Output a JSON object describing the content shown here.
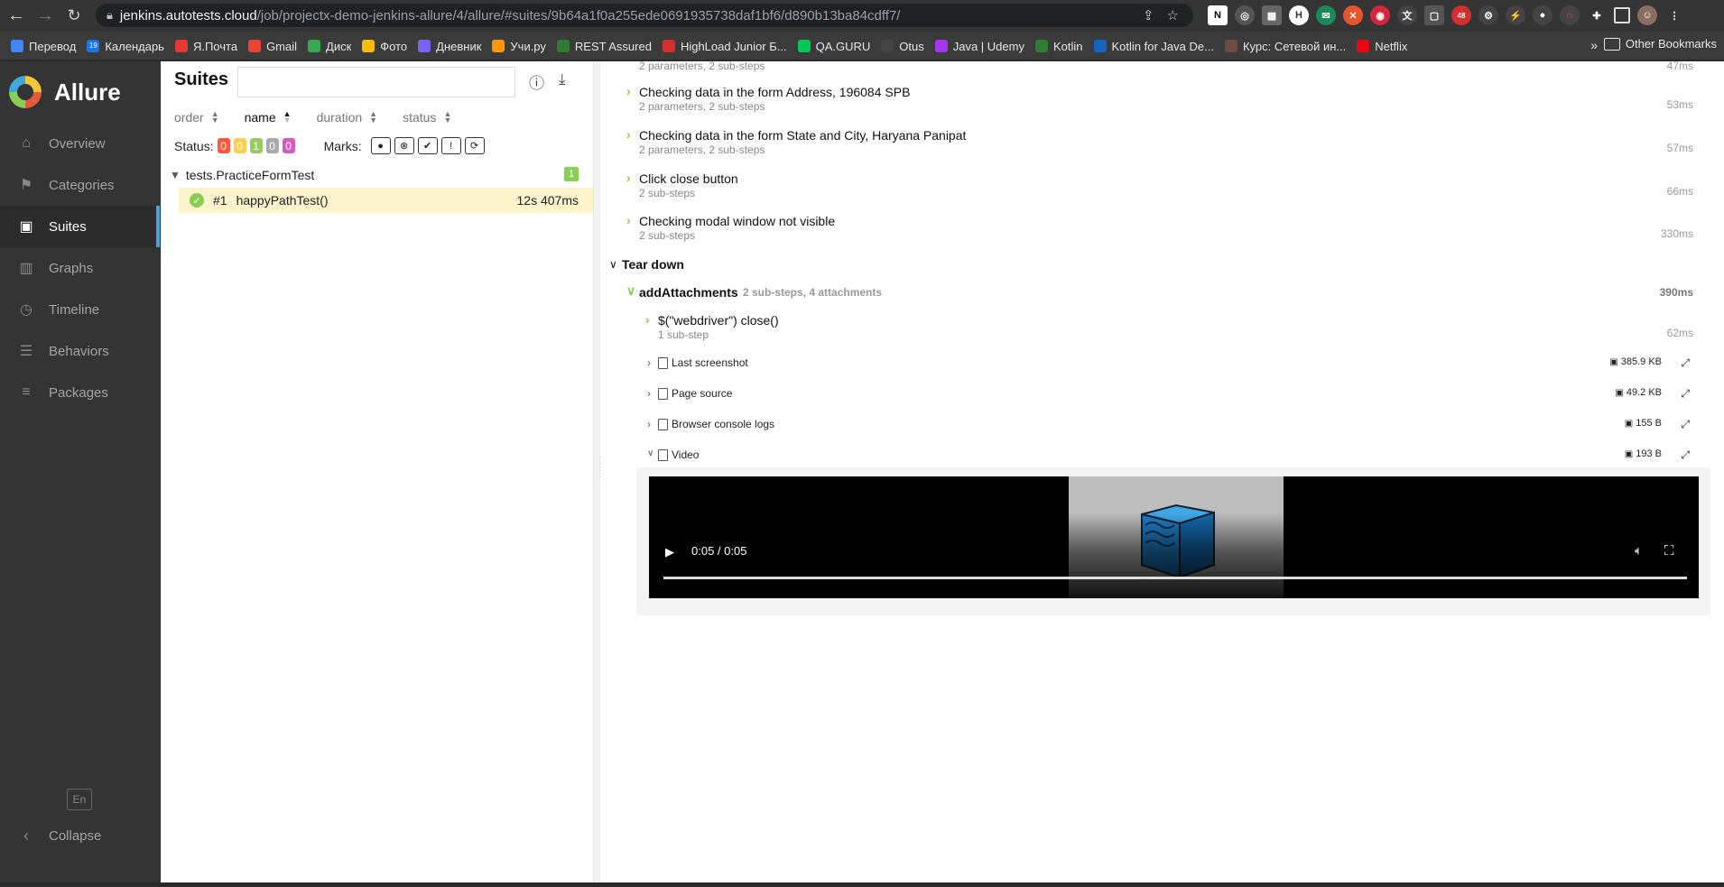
{
  "browser": {
    "url_host": "jenkins.autotests.cloud",
    "url_path": "/job/projectx-demo-jenkins-allure/4/allure/#suites/9b64a1f0a255ede0691935738daf1bf6/d890b13ba84cdff7/",
    "bookmarks": [
      "Перевод",
      "Календарь",
      "Я.Почта",
      "Gmail",
      "Диск",
      "Фото",
      "Дневник",
      "Учи.ру",
      "REST Assured",
      "HighLoad Junior Б...",
      "QA.GURU",
      "Otus",
      "Java | Udemy",
      "Kotlin",
      "Kotlin for Java De...",
      "Курс: Сетевой ин...",
      "Netflix"
    ],
    "bookmark_colors": [
      "#4285f4",
      "#1a73e8",
      "#e53935",
      "#ea4335",
      "#34a853",
      "#fbbc04",
      "#7b61ff",
      "#ff9800",
      "#2e7d32",
      "#d32f2f",
      "#00c853",
      "#444444",
      "#a435f0",
      "#2e7d32",
      "#1565c0",
      "#6d4c41",
      "#e50914"
    ],
    "more": "»",
    "other_bookmarks": "Other Bookmarks",
    "calendar_day": "19"
  },
  "sidebar": {
    "brand": "Allure",
    "items": [
      {
        "label": "Overview",
        "icon": "home-icon",
        "glyph": "⌂"
      },
      {
        "label": "Categories",
        "icon": "flag-icon",
        "glyph": "⚑"
      },
      {
        "label": "Suites",
        "icon": "briefcase-icon",
        "glyph": "▣"
      },
      {
        "label": "Graphs",
        "icon": "bar-chart-icon",
        "glyph": "▥"
      },
      {
        "label": "Timeline",
        "icon": "clock-icon",
        "glyph": "◷"
      },
      {
        "label": "Behaviors",
        "icon": "list-icon",
        "glyph": "☰"
      },
      {
        "label": "Packages",
        "icon": "align-left-icon",
        "glyph": "≡"
      }
    ],
    "active": "Suites",
    "lang": "En",
    "collapse": "Collapse"
  },
  "tree": {
    "title": "Suites",
    "sorters": [
      "order",
      "name",
      "duration",
      "status"
    ],
    "status_label": "Status:",
    "status_counts": [
      {
        "value": "0",
        "color": "#fd5a3e"
      },
      {
        "value": "0",
        "color": "#ffd050"
      },
      {
        "value": "1",
        "color": "#97cc64"
      },
      {
        "value": "0",
        "color": "#aaaaaa"
      },
      {
        "value": "0",
        "color": "#d35ebe"
      }
    ],
    "marks_label": "Marks:",
    "group": {
      "name": "tests.PracticeFormTest",
      "count": "1"
    },
    "test": {
      "num": "#1",
      "name": "happyPathTest()",
      "duration": "12s 407ms"
    }
  },
  "detail": {
    "steps": [
      {
        "title": "",
        "sub": "2 parameters, 2 sub-steps",
        "time": "47ms"
      },
      {
        "title": "Checking data in the form Address, 196084 SPB",
        "sub": "2 parameters, 2 sub-steps",
        "time": "53ms"
      },
      {
        "title": "Checking data in the form State and City, Haryana Panipat",
        "sub": "2 parameters, 2 sub-steps",
        "time": "57ms"
      },
      {
        "title": "Click close button",
        "sub": "2 sub-steps",
        "time": "66ms"
      },
      {
        "title": "Checking modal window not visible",
        "sub": "2 sub-steps",
        "time": "330ms"
      }
    ],
    "teardown_title": "Tear down",
    "fixture": {
      "name": "addAttachments",
      "meta": "2 sub-steps, 4 attachments",
      "time": "390ms"
    },
    "substep": {
      "title": "$(\"webdriver\") close()",
      "sub": "1 sub-step",
      "time": "62ms"
    },
    "attachments": [
      {
        "name": "Last screenshot",
        "size": "385.9 KB",
        "expanded": false
      },
      {
        "name": "Page source",
        "size": "49.2 KB",
        "expanded": false
      },
      {
        "name": "Browser console logs",
        "size": "155 B",
        "expanded": false
      },
      {
        "name": "Video",
        "size": "193 B",
        "expanded": true
      }
    ],
    "video": {
      "time": "0:05 / 0:05",
      "progress": 1.0
    }
  }
}
